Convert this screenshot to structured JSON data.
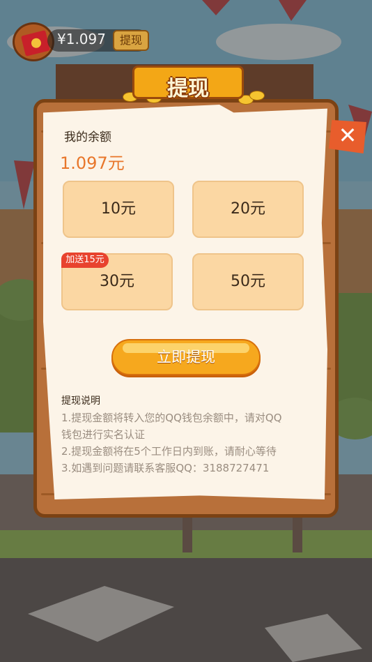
{
  "hud": {
    "balance": "¥1.097",
    "withdraw_label": "提现"
  },
  "dialog": {
    "title": "提现",
    "close_glyph": "✕",
    "balance_label": "我的余额",
    "balance_value": "1.097元",
    "options": [
      {
        "label": "10元"
      },
      {
        "label": "20元"
      },
      {
        "label": "30元",
        "tag": "加送15元"
      },
      {
        "label": "50元"
      }
    ],
    "withdraw_button": "立即提现",
    "notes_title": "提现说明",
    "notes_lines": [
      "1.提现金额将转入您的QQ钱包余额中，请对QQ",
      "钱包进行实名认证",
      "2.提现金额将在5个工作日内到账，请耐心等待",
      "3.如遇到问题请联系客服QQ：3188727471"
    ]
  },
  "colors": {
    "accent": "#e8762a",
    "button": "#f6a81e",
    "tile": "#fbd7a3",
    "tag": "#e8432e"
  }
}
